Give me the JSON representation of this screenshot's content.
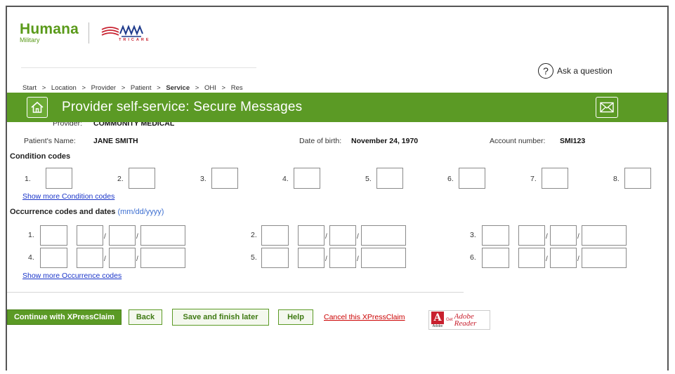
{
  "brand": {
    "name": "Humana",
    "sub": "Military",
    "partner": "TRICARE"
  },
  "breadcrumb": {
    "items": [
      "Start",
      "Location",
      "Provider",
      "Patient",
      "Service",
      "OHI",
      "Res"
    ],
    "separator": ">",
    "current": "Service"
  },
  "help": {
    "ask_label": "Ask a question"
  },
  "header": {
    "title": "Provider self-service: Secure Messages"
  },
  "patient": {
    "provider_label": "Provider:",
    "provider_value": "COMMUNITY MEDICAL",
    "name_label": "Patient's Name:",
    "name_value": "JANE SMITH",
    "dob_label": "Date of birth:",
    "dob_value": "November 24, 1970",
    "account_label": "Account number:",
    "account_value": "SMI123"
  },
  "condition": {
    "title": "Condition codes",
    "numbers": [
      "1.",
      "2.",
      "3.",
      "4.",
      "5.",
      "6.",
      "7.",
      "8."
    ],
    "show_more": "Show more Condition codes"
  },
  "occurrence": {
    "title": "Occurrence codes and dates",
    "hint": "(mm/dd/yyyy)",
    "numbers": [
      "1.",
      "2.",
      "3.",
      "4.",
      "5.",
      "6."
    ],
    "show_more": "Show more Occurrence codes"
  },
  "actions": {
    "continue": "Continue with XPressClaim",
    "back": "Back",
    "save": "Save and finish later",
    "help": "Help",
    "cancel": "Cancel this XPressClaim",
    "adobe_get": "Get",
    "adobe_label": "Adobe",
    "adobe_reader": "Reader",
    "adobe_small": "Adobe"
  },
  "colors": {
    "brand_green": "#5b9a25",
    "link_blue": "#1a35c9",
    "cancel_red": "#cc0000"
  },
  "icons": [
    "home-icon",
    "mail-icon",
    "question-icon",
    "tricare-flag-icon",
    "adobe-icon"
  ]
}
